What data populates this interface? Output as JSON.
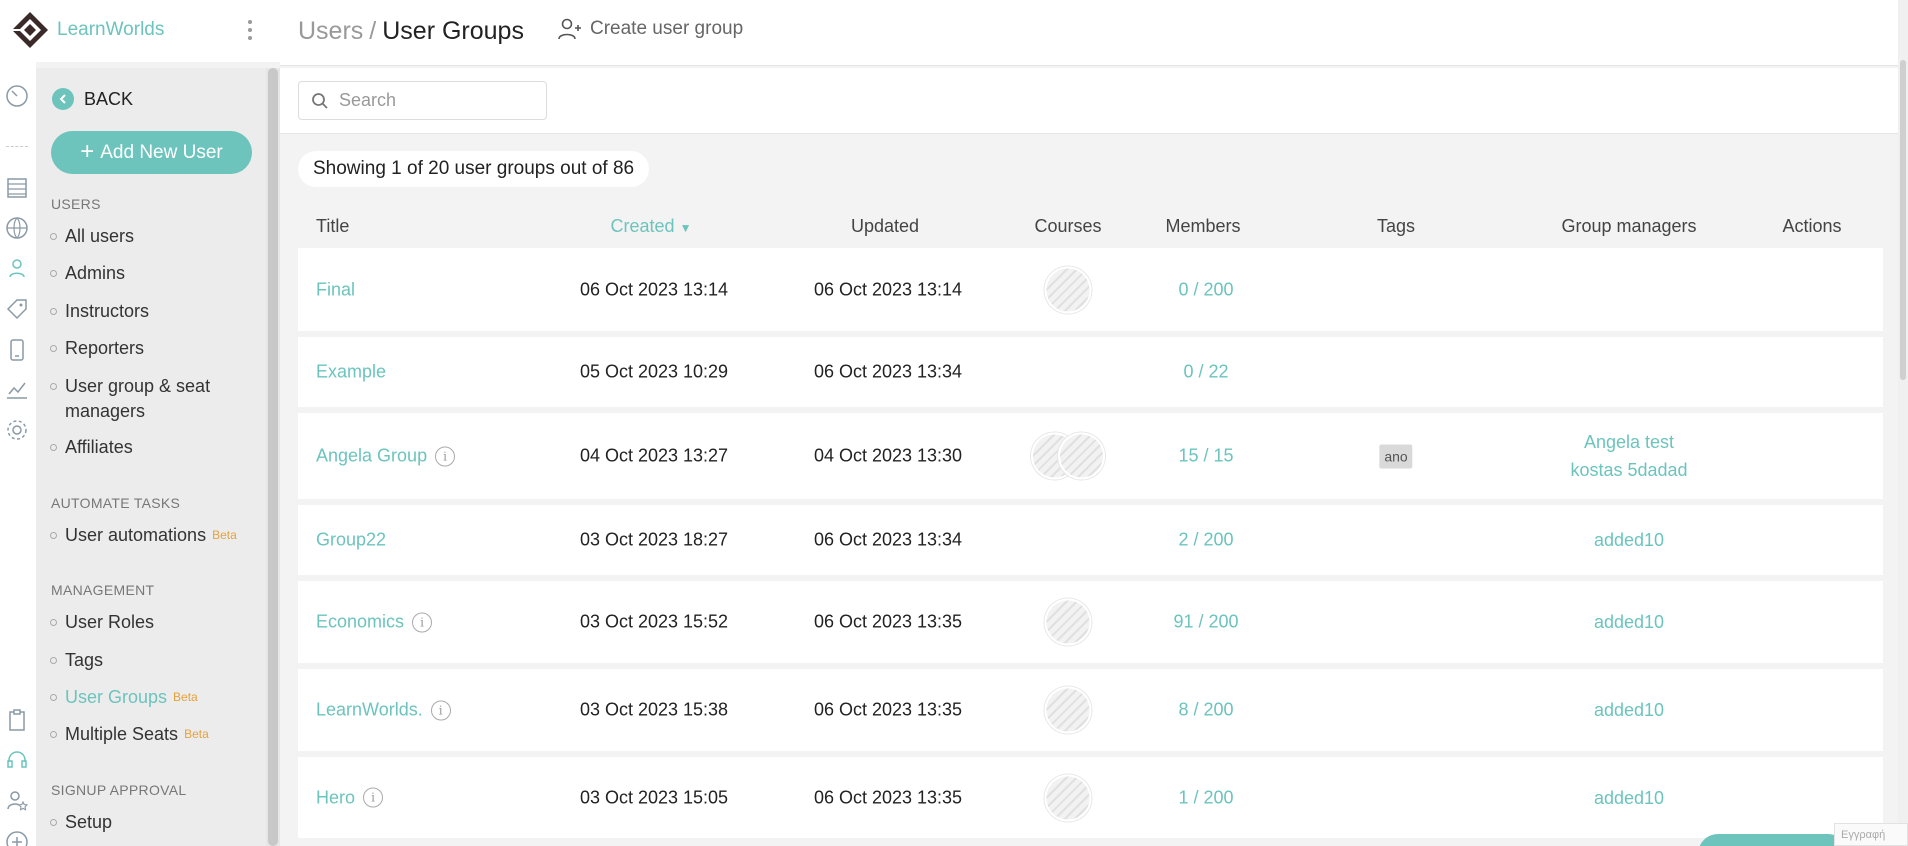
{
  "app": {
    "brand": "LearnWorlds"
  },
  "header": {
    "breadcrumb_parent": "Users",
    "breadcrumb_separator": "/",
    "breadcrumb_current": "User Groups",
    "create_label": "Create user group"
  },
  "search": {
    "placeholder": "Search",
    "value": ""
  },
  "sidebar": {
    "back_label": "BACK",
    "add_user_label": "Add New User",
    "sections": {
      "users": "USERS",
      "automate": "AUTOMATE TASKS",
      "management": "MANAGEMENT",
      "signup": "SIGNUP APPROVAL"
    },
    "items": {
      "all_users": "All users",
      "admins": "Admins",
      "instructors": "Instructors",
      "reporters": "Reporters",
      "seat_managers_line1": "User group & seat",
      "seat_managers_line2": "managers",
      "affiliates": "Affiliates",
      "automations": "User automations",
      "roles": "User Roles",
      "tags": "Tags",
      "user_groups": "User Groups",
      "multiple_seats": "Multiple Seats",
      "setup": "Setup"
    },
    "beta_label": "Beta"
  },
  "summary": "Showing 1 of 20 user groups out of 86",
  "table": {
    "columns": {
      "title": "Title",
      "created": "Created",
      "updated": "Updated",
      "courses": "Courses",
      "members": "Members",
      "tags": "Tags",
      "managers": "Group managers",
      "actions": "Actions"
    },
    "sort_indicator": "▼",
    "rows": [
      {
        "title": "Final",
        "created": "06 Oct 2023 13:14",
        "updated": "06 Oct 2023 13:14",
        "courses": 1,
        "members": "0 / 200",
        "info": false
      },
      {
        "title": "Example",
        "created": "05 Oct 2023 10:29",
        "updated": "06 Oct 2023 13:34",
        "courses": 0,
        "members": "0 / 22",
        "info": false
      },
      {
        "title": "Angela Group",
        "created": "04 Oct 2023 13:27",
        "updated": "04 Oct 2023 13:30",
        "courses": 2,
        "members": "15 / 15",
        "tag": "ano",
        "managers": [
          "Angela test",
          "kostas 5dadad"
        ],
        "info": true
      },
      {
        "title": "Group22",
        "created": "03 Oct 2023 18:27",
        "updated": "06 Oct 2023 13:34",
        "courses": 0,
        "members": "2 / 200",
        "managers": [
          "added10"
        ],
        "info": false
      },
      {
        "title": "Economics",
        "created": "03 Oct 2023 15:52",
        "updated": "06 Oct 2023 13:35",
        "courses": 1,
        "members": "91 / 200",
        "managers": [
          "added10"
        ],
        "info": true
      },
      {
        "title": "LearnWorlds.",
        "created": "03 Oct 2023 15:38",
        "updated": "06 Oct 2023 13:35",
        "courses": 1,
        "members": "8 / 200",
        "managers": [
          "added10"
        ],
        "info": true
      },
      {
        "title": "Hero",
        "created": "03 Oct 2023 15:05",
        "updated": "06 Oct 2023 13:35",
        "courses": 1,
        "members": "1 / 200",
        "managers": [
          "added10"
        ],
        "info": true
      }
    ]
  },
  "corner_badge": "Εγγραφή",
  "colors": {
    "accent": "#6cc4bd",
    "beta": "#e6a23c"
  }
}
